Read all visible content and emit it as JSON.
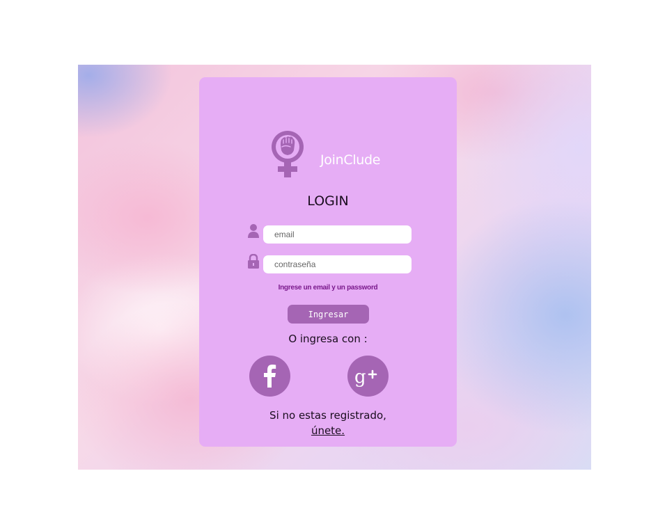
{
  "brand": {
    "name": "JoinClude",
    "logo_icon": "feminist-fist-venus-icon"
  },
  "login": {
    "title": "LOGIN",
    "email_placeholder": "email",
    "password_placeholder": "contraseña",
    "email_icon": "user-icon",
    "password_icon": "lock-icon",
    "hint": "Ingrese un email y un password",
    "submit_label": "Ingresar"
  },
  "social": {
    "label": "O ingresa con :",
    "providers": [
      {
        "name": "facebook",
        "icon": "facebook-icon"
      },
      {
        "name": "google-plus",
        "icon": "google-plus-icon"
      }
    ]
  },
  "register": {
    "text": "Si no estas registrado,",
    "link_label": "únete."
  },
  "colors": {
    "card_background": "#e6adf5",
    "accent": "#a565b4",
    "hint_text": "#7a1a8c",
    "brand_text": "#ffffff"
  }
}
